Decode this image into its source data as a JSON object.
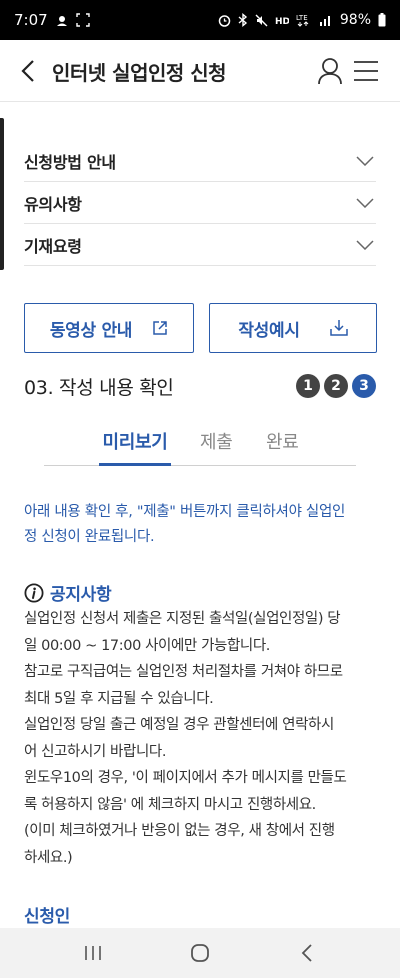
{
  "status_bar": {
    "time": "7:07",
    "battery": "98%"
  },
  "header": {
    "title": "인터넷 실업인정 신청"
  },
  "accordion": [
    {
      "label": "신청방법 안내"
    },
    {
      "label": "유의사항"
    },
    {
      "label": "기재요령"
    }
  ],
  "buttons": {
    "video_guide": "동영상 안내",
    "writing_example": "작성예시"
  },
  "step": {
    "title": "03. 작성 내용 확인",
    "indicators": [
      "1",
      "2",
      "3"
    ],
    "active": 3
  },
  "tabs": [
    {
      "label": "미리보기",
      "active": true
    },
    {
      "label": "제출",
      "active": false
    },
    {
      "label": "완료",
      "active": false
    }
  ],
  "intro": {
    "lines": [
      "아래 내용 확인 후, \"제출\" 버튼까지 클릭하셔야 실업인",
      "정 신청이 완료됩니다."
    ]
  },
  "notice": {
    "title": "공지사항",
    "lines": [
      "실업인정 신청서 제출은 지정된 출석일(실업인정일) 당",
      "일 00:00 ~ 17:00 사이에만 가능합니다.",
      "참고로 구직급여는 실업인정 처리절차를 거쳐야 하므로",
      "최대 5일 후 지급될 수 있습니다.",
      "실업인정 당일 출근 예정일 경우 관할센터에 연락하시",
      "어 신고하시기 바랍니다.",
      "윈도우10의 경우, '이 페이지에서 추가 메시지를 만들도",
      "록 허용하지 않음' 에 체크하지 마시고 진행하세요.",
      "(이미 체크하였거나 반응이 없는 경우, 새 창에서 진행",
      "하세요.)"
    ]
  },
  "applicant": {
    "title": "신청인"
  },
  "colors": {
    "accent": "#2a5bab",
    "text": "#222222",
    "muted": "#888888"
  }
}
